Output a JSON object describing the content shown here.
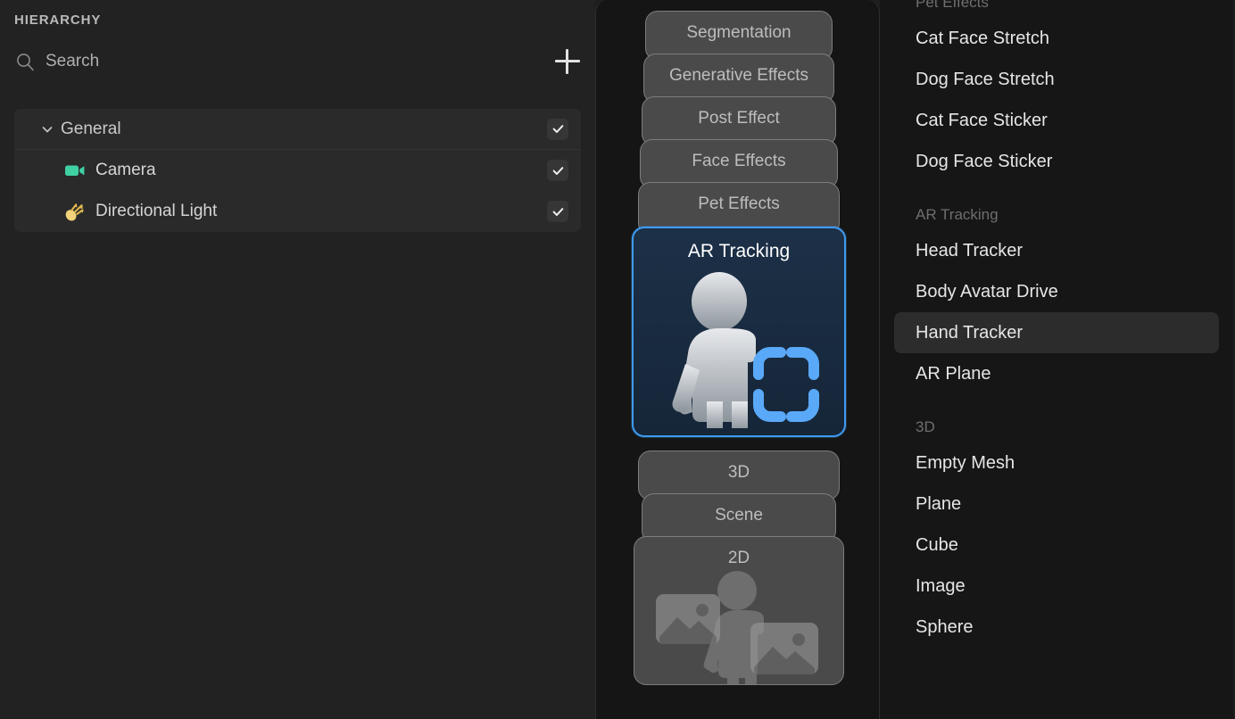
{
  "hierarchy": {
    "title": "HIERARCHY",
    "search": {
      "placeholder": "Search",
      "value": "Search",
      "icon": "search-icon"
    },
    "add_button": {
      "icon": "plus-icon",
      "label": "+"
    },
    "tree": [
      {
        "label": "General",
        "type": "group",
        "expanded": true,
        "chevron": "chevron-down-icon",
        "checked": true,
        "children": [
          {
            "label": "Camera",
            "icon": "camera-icon",
            "icon_color": "#3fd0a3",
            "checked": true
          },
          {
            "label": "Directional Light",
            "icon": "directional-light-icon",
            "icon_color": "#f2d27a",
            "checked": true
          }
        ]
      }
    ]
  },
  "card_stack": {
    "cards": [
      {
        "label": "Segmentation",
        "active": false
      },
      {
        "label": "Generative Effects",
        "active": false
      },
      {
        "label": "Post Effect",
        "active": false
      },
      {
        "label": "Face Effects",
        "active": false
      },
      {
        "label": "Pet Effects",
        "active": false
      },
      {
        "label": "AR Tracking",
        "active": true,
        "icon": "ar-tracking-person-icon"
      },
      {
        "label": "3D",
        "active": false
      },
      {
        "label": "Scene",
        "active": false
      },
      {
        "label": "2D",
        "active": false,
        "icon": "two-d-images-person-icon"
      }
    ],
    "active_index": 5,
    "accent_color": "#3e9bf0",
    "card_color": "#4a4a4a",
    "active_card_color": "#182a42"
  },
  "menu": {
    "sections": [
      {
        "title": "Pet Effects",
        "items": [
          "Cat Face Stretch",
          "Dog Face Stretch",
          "Cat Face Sticker",
          "Dog Face Sticker"
        ]
      },
      {
        "title": "AR Tracking",
        "items": [
          "Head Tracker",
          "Body Avatar Drive",
          "Hand Tracker",
          "AR Plane"
        ]
      },
      {
        "title": "3D",
        "items": [
          "Empty Mesh",
          "Plane",
          "Cube",
          "Image",
          "Sphere"
        ]
      }
    ],
    "selected_item": "Hand Tracker",
    "selected_section": "AR Tracking"
  }
}
